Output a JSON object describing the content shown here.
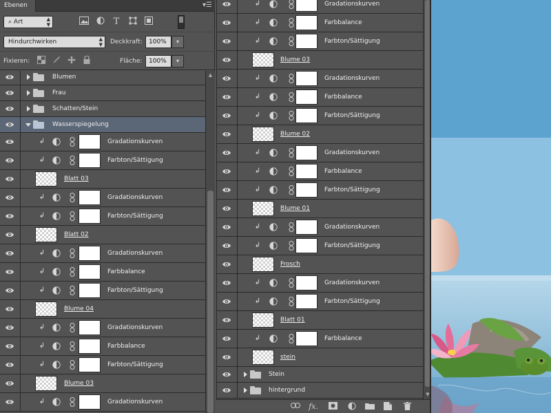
{
  "panel": {
    "tab_label": "Ebenen",
    "menu_glyph": "▾☰",
    "filter": {
      "type_label": "Art"
    },
    "blend_mode": "Hindurchwirken",
    "opacity_label": "Deckkraft:",
    "opacity_value": "100%",
    "lock_label": "Fixieren:",
    "fill_label": "Fläche:",
    "fill_value": "100%"
  },
  "left_layers": [
    {
      "kind": "group",
      "name": "Blumen",
      "open": false
    },
    {
      "kind": "group",
      "name": "Frau",
      "open": false
    },
    {
      "kind": "group",
      "name": "Schatten/Stein",
      "open": false
    },
    {
      "kind": "group",
      "name": "Wasserspiegelung",
      "open": true,
      "selected": true
    },
    {
      "kind": "adj",
      "name": "Gradationskurven"
    },
    {
      "kind": "adj",
      "name": "Farbton/Sättigung"
    },
    {
      "kind": "smart",
      "name": "Blatt 03"
    },
    {
      "kind": "adj",
      "name": "Gradationskurven"
    },
    {
      "kind": "adj",
      "name": "Farbton/Sättigung"
    },
    {
      "kind": "smart",
      "name": "Blatt 02"
    },
    {
      "kind": "adj",
      "name": "Gradationskurven"
    },
    {
      "kind": "adj",
      "name": "Farbbalance"
    },
    {
      "kind": "adj",
      "name": "Farbton/Sättigung"
    },
    {
      "kind": "smart",
      "name": "Blume 04"
    },
    {
      "kind": "adj",
      "name": "Gradationskurven"
    },
    {
      "kind": "adj",
      "name": "Farbbalance"
    },
    {
      "kind": "adj",
      "name": "Farbton/Sättigung"
    },
    {
      "kind": "smart",
      "name": "Blume 03"
    },
    {
      "kind": "adj",
      "name": "Gradationskurven"
    }
  ],
  "right_layers": [
    {
      "kind": "adj",
      "name": "Gradationskurven"
    },
    {
      "kind": "adj",
      "name": "Farbbalance"
    },
    {
      "kind": "adj",
      "name": "Farbton/Sättigung"
    },
    {
      "kind": "smart",
      "name": "Blume 03"
    },
    {
      "kind": "adj",
      "name": "Gradationskurven"
    },
    {
      "kind": "adj",
      "name": "Farbbalance"
    },
    {
      "kind": "adj",
      "name": "Farbton/Sättigung"
    },
    {
      "kind": "smart",
      "name": "Blume 02"
    },
    {
      "kind": "adj",
      "name": "Gradationskurven"
    },
    {
      "kind": "adj",
      "name": "Farbbalance"
    },
    {
      "kind": "adj",
      "name": "Farbton/Sättigung"
    },
    {
      "kind": "smart",
      "name": "Blume 01"
    },
    {
      "kind": "adj",
      "name": "Gradationskurven"
    },
    {
      "kind": "adj",
      "name": "Farbton/Sättigung"
    },
    {
      "kind": "smart",
      "name": "Frosch"
    },
    {
      "kind": "adj",
      "name": "Gradationskurven"
    },
    {
      "kind": "adj",
      "name": "Farbton/Sättigung"
    },
    {
      "kind": "smart",
      "name": "Blatt 01"
    },
    {
      "kind": "adj",
      "name": "Farbbalance"
    },
    {
      "kind": "smart",
      "name": "stein"
    },
    {
      "kind": "group",
      "name": "Stein",
      "open": false
    },
    {
      "kind": "group",
      "name": "hintergrund",
      "open": false
    }
  ],
  "colors": {
    "panel_bg": "#535353",
    "selected_row": "#5b6677",
    "divider": "#2a2a2a"
  }
}
